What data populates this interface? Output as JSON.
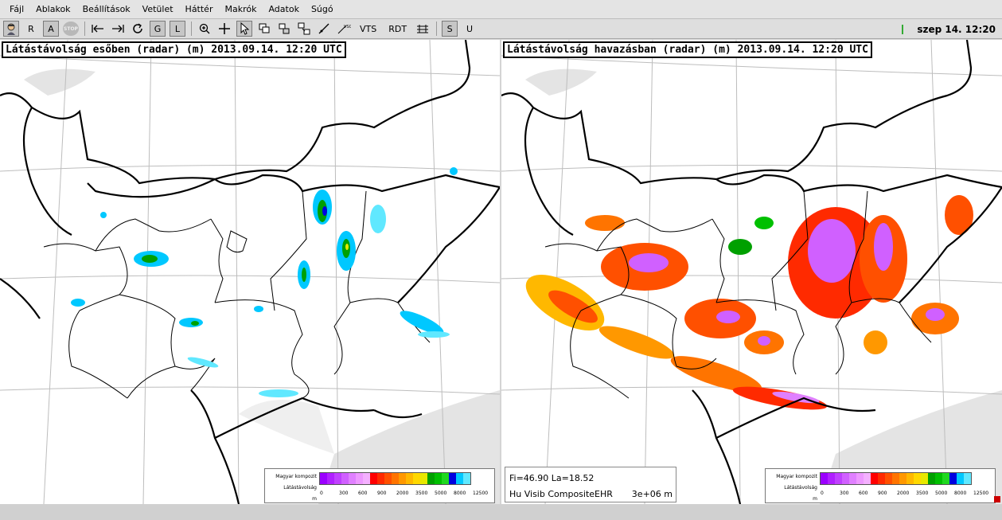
{
  "menubar": {
    "items": [
      "Fájl",
      "Ablakok",
      "Beállítások",
      "Vetület",
      "Háttér",
      "Makrók",
      "Adatok",
      "Súgó"
    ]
  },
  "toolbar": {
    "app_icon": "user-avatar-icon",
    "btn_r": "R",
    "btn_a": "A",
    "btn_stop": "STOP",
    "btn_g": "G",
    "btn_l": "L",
    "btn_vts": "VTS",
    "btn_rdt": "RDT",
    "btn_s": "S",
    "btn_u": "U"
  },
  "clock": "szep 14. 12:20",
  "left_map": {
    "title": "Látástávolság esőben (radar) (m) 2013.09.14. 12:20 UTC"
  },
  "right_map": {
    "title": "Látástávolság havazásban (radar) (m) 2013.09.14. 12:20 UTC"
  },
  "legend": {
    "label1": "Magyar kompozit",
    "label2": "Látástávolság",
    "label3": "m",
    "colors": [
      "#9b00ff",
      "#b020ff",
      "#c040ff",
      "#d060ff",
      "#e080ff",
      "#ee99ff",
      "#f4b0ff",
      "#ff0000",
      "#ff2a00",
      "#ff5000",
      "#ff7400",
      "#ff9800",
      "#ffb800",
      "#ffd800",
      "#e8e800",
      "#00a000",
      "#00c000",
      "#20d820",
      "#0000e0",
      "#00c8ff",
      "#60e8ff"
    ],
    "ticks": [
      "0",
      "300",
      "600",
      "900",
      "2000",
      "3500",
      "5000",
      "8000",
      "12500"
    ]
  },
  "info": {
    "coords": "Fi=46.90 La=18.52",
    "product": "Hu Visib CompositeEHR",
    "scale": "3e+06 m"
  }
}
